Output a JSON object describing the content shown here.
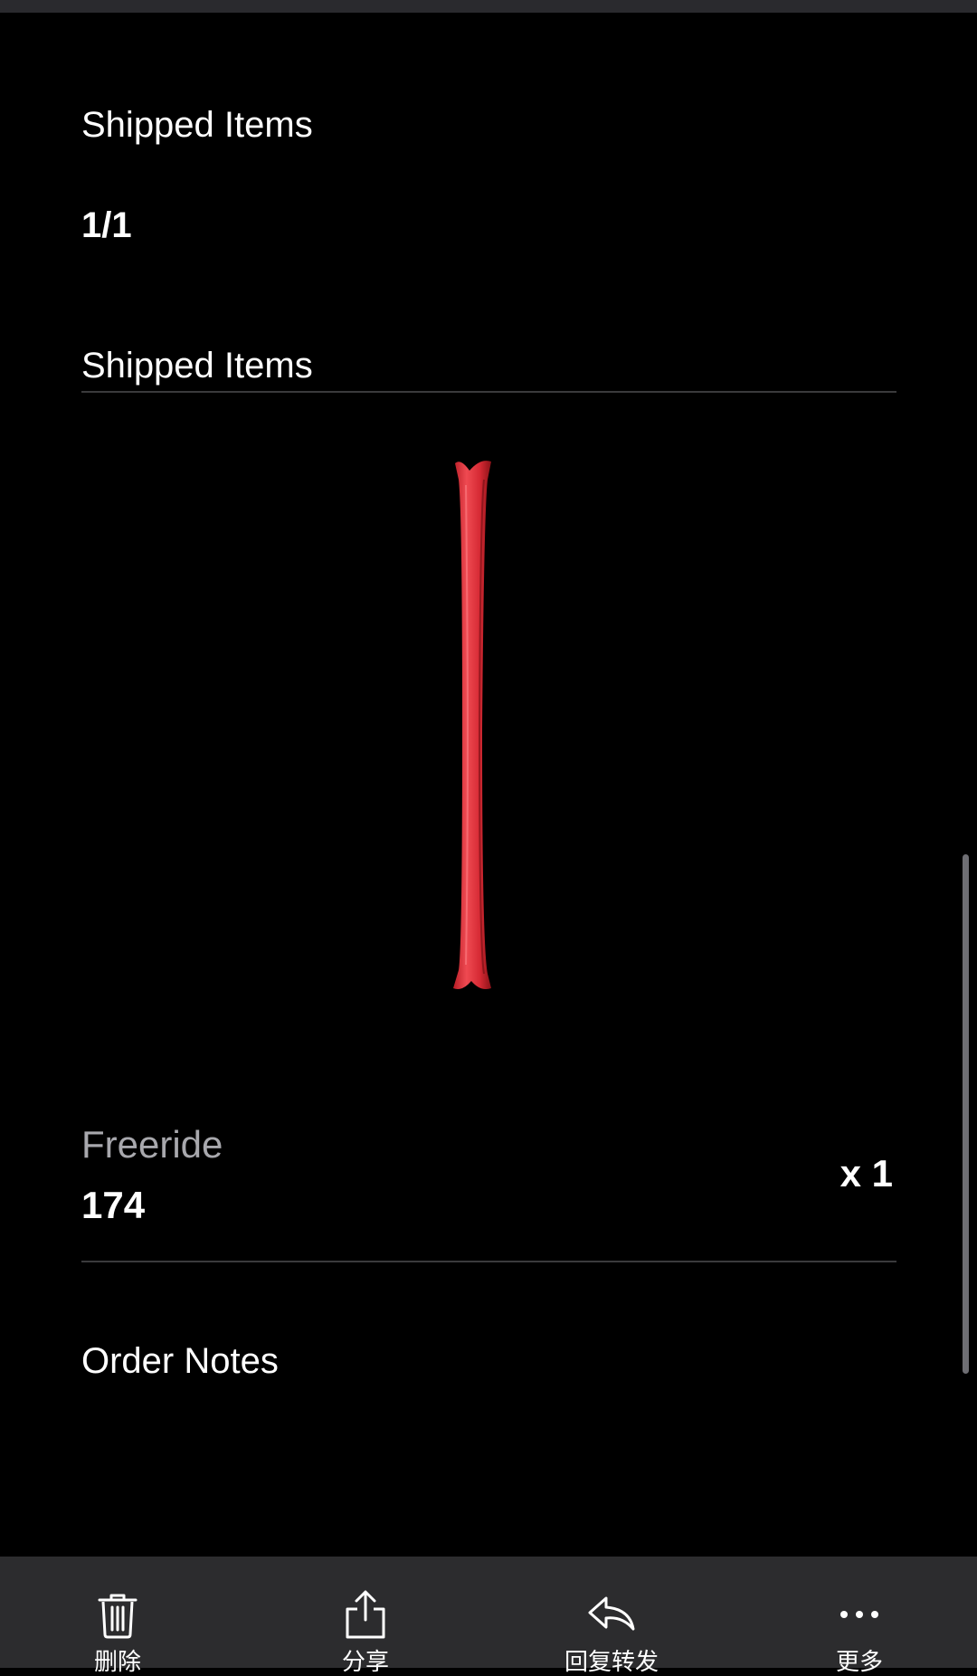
{
  "order": {
    "shipped_items_label": "Shipped Items",
    "shipped_count": "1/1",
    "shipped_items_header": "Shipped Items",
    "item": {
      "name": "Freeride",
      "size": "174",
      "quantity": "x 1",
      "image_icon": "ski-product-image",
      "image_color": "#e0303a"
    },
    "order_notes_label": "Order Notes"
  },
  "toolbar": {
    "delete_label": "删除",
    "share_label": "分享",
    "reply_forward_label": "回复转发",
    "more_label": "更多"
  },
  "colors": {
    "background": "#000000",
    "toolbar_background": "#2c2c2e",
    "divider": "#3a3a3c",
    "muted_text": "#a8a8ad"
  }
}
